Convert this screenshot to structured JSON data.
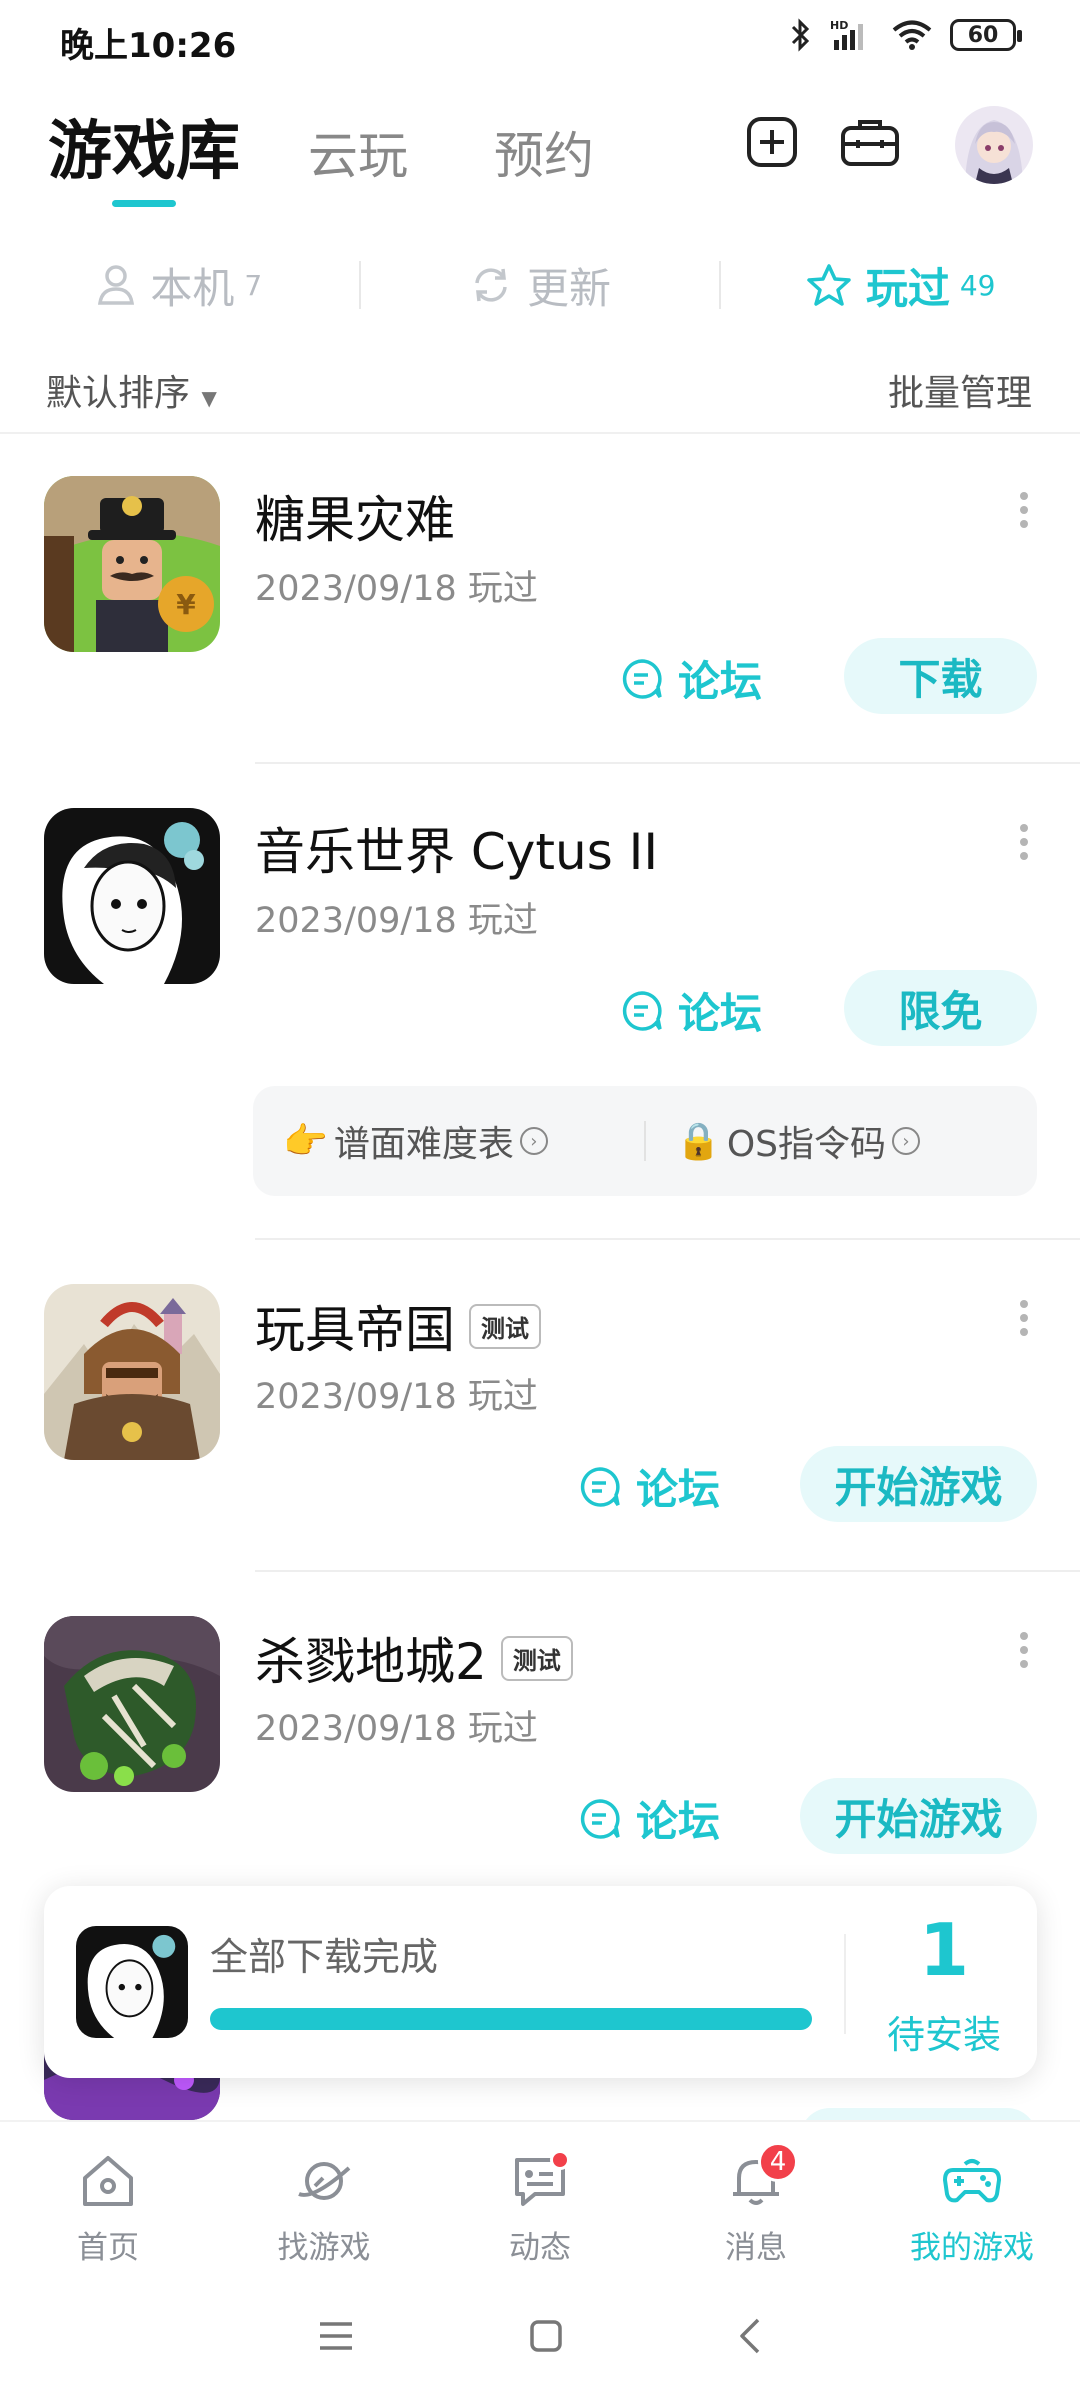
{
  "status_bar": {
    "time": "晚上10:26",
    "battery": "60",
    "network": "HD"
  },
  "header": {
    "tabs": [
      {
        "label": "游戏库",
        "active": true
      },
      {
        "label": "云玩",
        "active": false
      },
      {
        "label": "预约",
        "active": false
      }
    ],
    "icons": [
      "add-square-icon",
      "toolbox-icon",
      "avatar"
    ]
  },
  "filters": [
    {
      "label": "本机",
      "count": "7",
      "icon": "person-icon"
    },
    {
      "label": "更新",
      "count": "",
      "icon": "refresh-icon"
    },
    {
      "label": "玩过",
      "count": "49",
      "icon": "star-icon",
      "active": true
    }
  ],
  "sort": {
    "label": "默认排序",
    "batch": "批量管理"
  },
  "games": [
    {
      "name": "糖果灾难",
      "badge": "",
      "date": "2023/09/18 玩过",
      "forum": "论坛",
      "action": "下载"
    },
    {
      "name": "音乐世界 Cytus II",
      "badge": "",
      "date": "2023/09/18 玩过",
      "forum": "论坛",
      "action": "限免",
      "tips": [
        {
          "emoji": "👉",
          "label": "谱面难度表"
        },
        {
          "emoji": "🔒",
          "label": "OS指令码"
        }
      ]
    },
    {
      "name": "玩具帝国",
      "badge": "测试",
      "date": "2023/09/18 玩过",
      "forum": "论坛",
      "action": "开始游戏"
    },
    {
      "name": "杀戮地城2",
      "badge": "测试",
      "date": "2023/09/18 玩过",
      "forum": "论坛",
      "action": "开始游戏"
    }
  ],
  "download_panel": {
    "status": "全部下载完成",
    "progress": 1.0,
    "count": "1",
    "count_label": "待安装"
  },
  "bottom_nav": [
    {
      "label": "首页",
      "icon": "home-icon"
    },
    {
      "label": "找游戏",
      "icon": "planet-icon"
    },
    {
      "label": "动态",
      "icon": "chat-icon",
      "dot": true
    },
    {
      "label": "消息",
      "icon": "bell-icon",
      "badge": "4"
    },
    {
      "label": "我的游戏",
      "icon": "gamepad-icon",
      "active": true
    }
  ],
  "colors": {
    "accent": "#1ec6cf",
    "badge_red": "#f2404a"
  }
}
